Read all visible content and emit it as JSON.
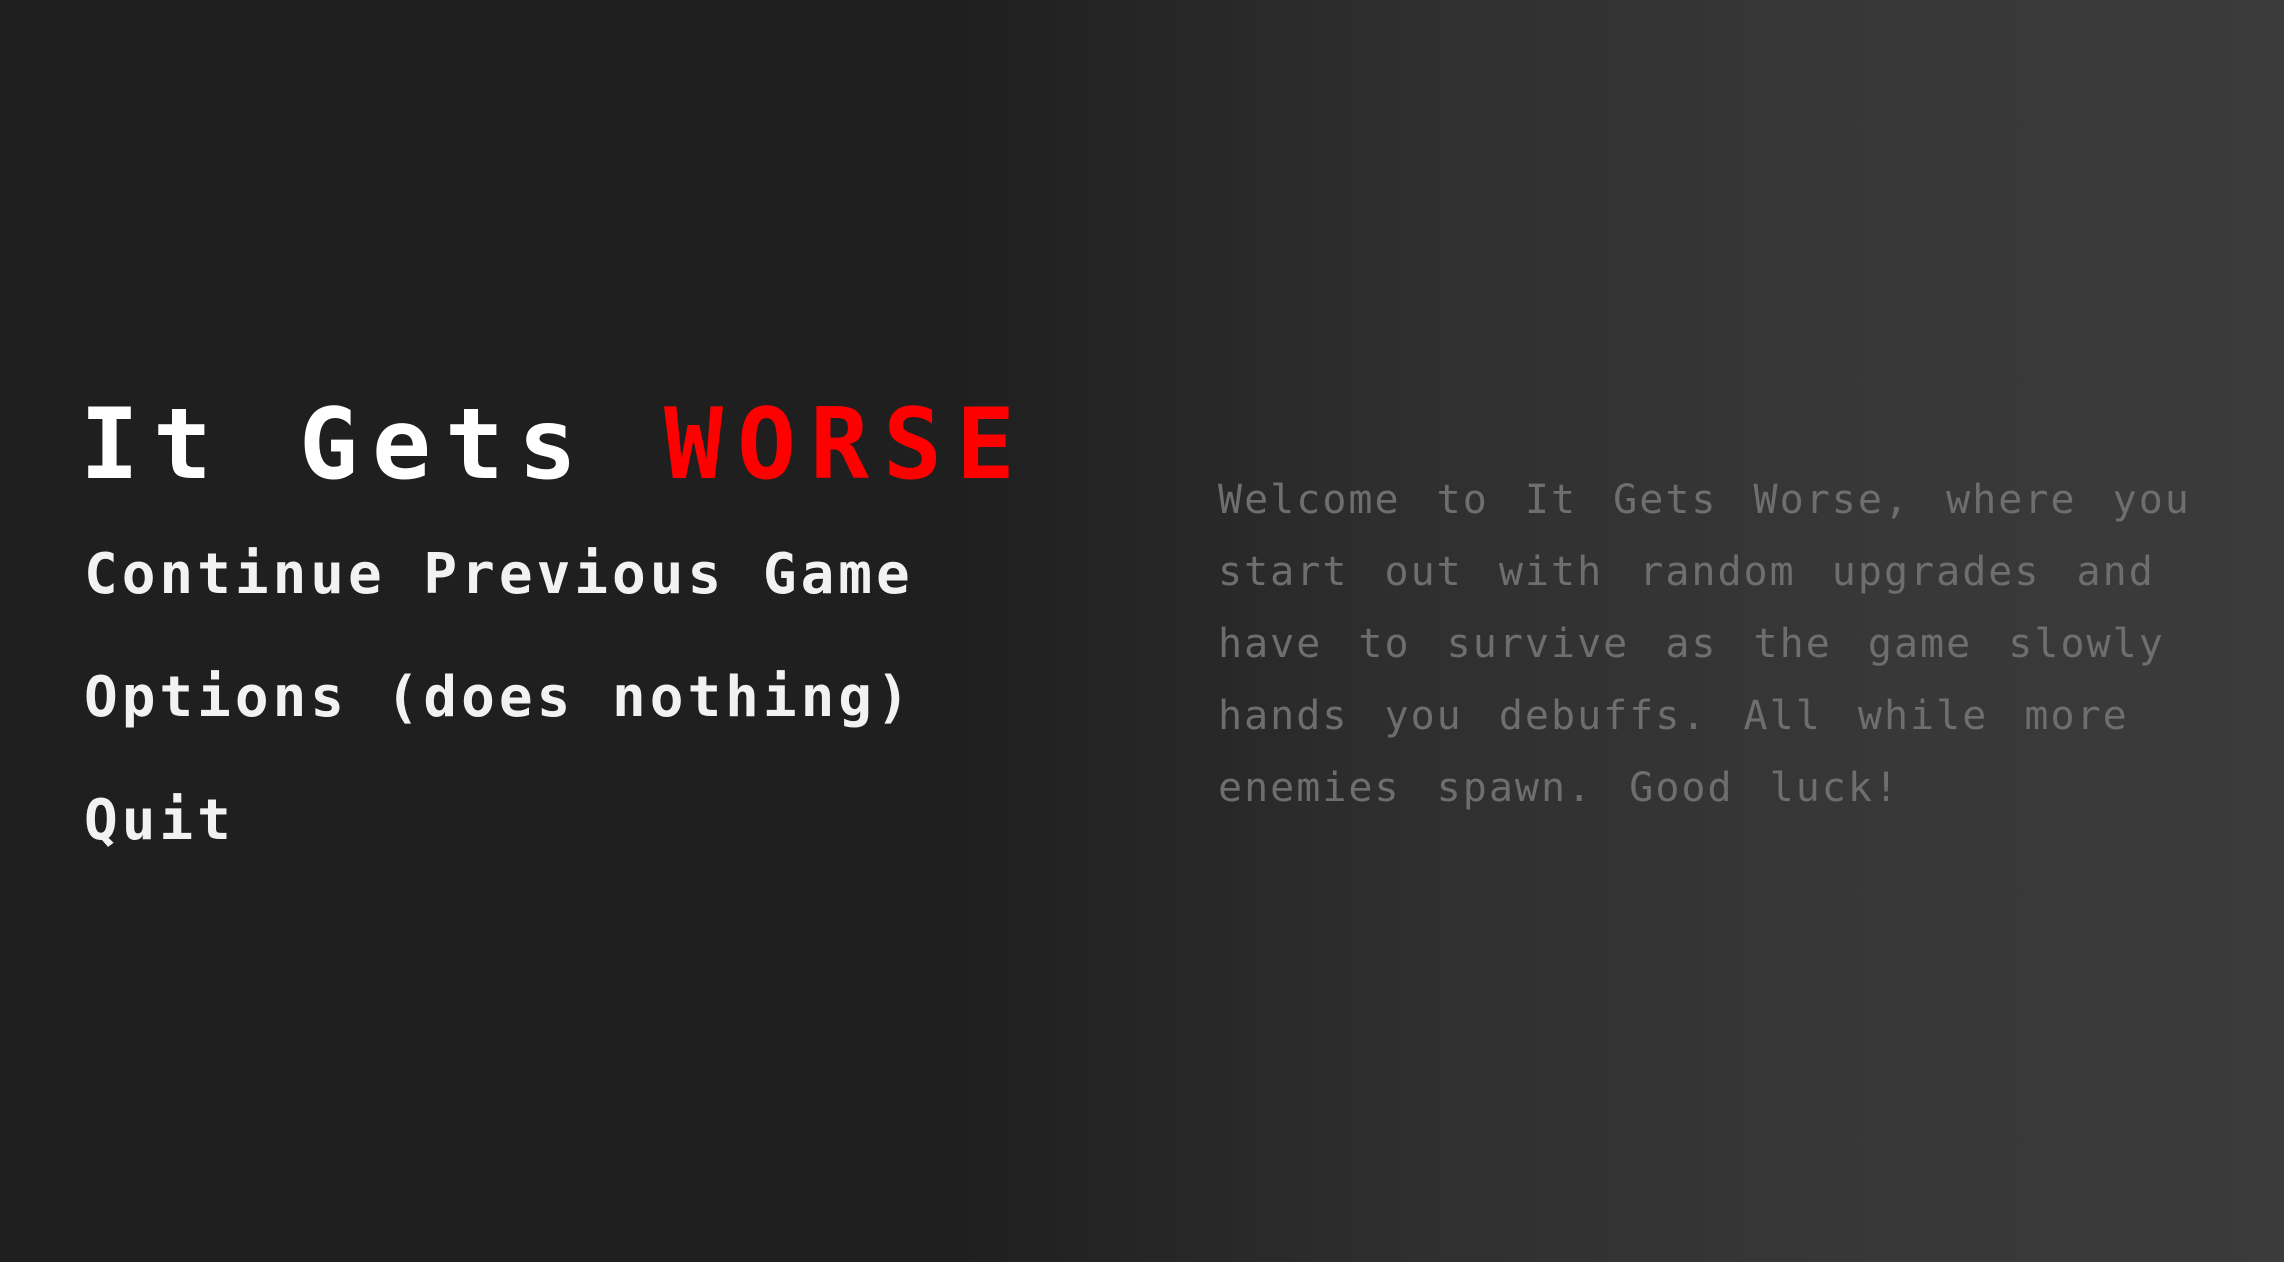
{
  "title": {
    "main": "It Gets",
    "accent": "WORSE",
    "accent_color": "#ff0000"
  },
  "menu": {
    "items": [
      {
        "label": "Continue Previous Game"
      },
      {
        "label": "Options (does nothing)"
      },
      {
        "label": "Quit"
      }
    ]
  },
  "description": {
    "text": "Welcome to It Gets Worse, where you start out with random upgrades and have to survive as the game slowly hands you debuffs. All while more enemies spawn. Good luck!"
  }
}
